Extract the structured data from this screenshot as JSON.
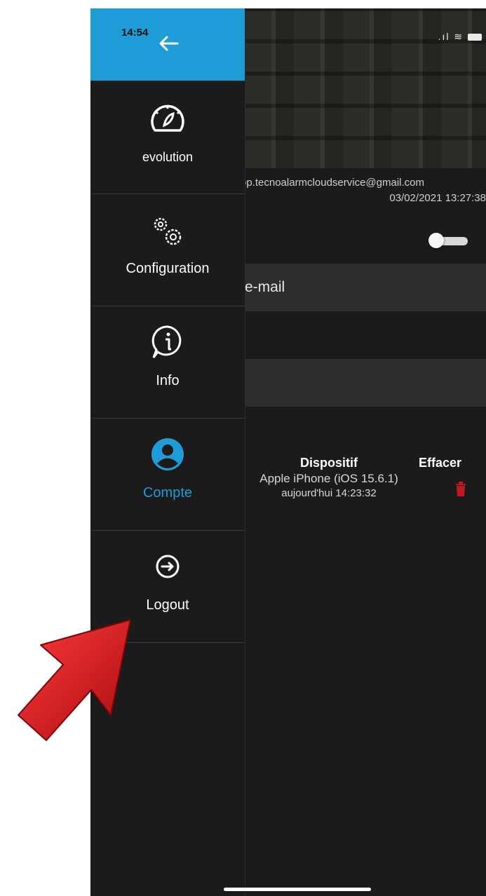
{
  "status": {
    "time": "14:54"
  },
  "drawer": {
    "items": [
      {
        "label": "evolution",
        "icon": "gauge-icon"
      },
      {
        "label": "Configuration",
        "icon": "gears-icon"
      },
      {
        "label": "Info",
        "icon": "info-icon"
      },
      {
        "label": "Compte",
        "icon": "user-icon",
        "active": true
      },
      {
        "label": "Logout",
        "icon": "logout-icon"
      }
    ]
  },
  "account": {
    "email": "pp.tecnoalarmcloudservice@gmail.com",
    "date": "03/02/2021 13:27:38",
    "email_field_label": "e-mail"
  },
  "devices": {
    "header_device": "Dispositif",
    "header_erase": "Effacer",
    "device_name": "Apple iPhone (iOS 15.6.1)",
    "device_time": "aujourd'hui 14:23:32"
  },
  "colors": {
    "accent": "#1e9cd7",
    "background": "#1b1b1b",
    "field": "#2e2e2e",
    "delete": "#c0181f",
    "annotation_arrow": "#d8141c"
  }
}
